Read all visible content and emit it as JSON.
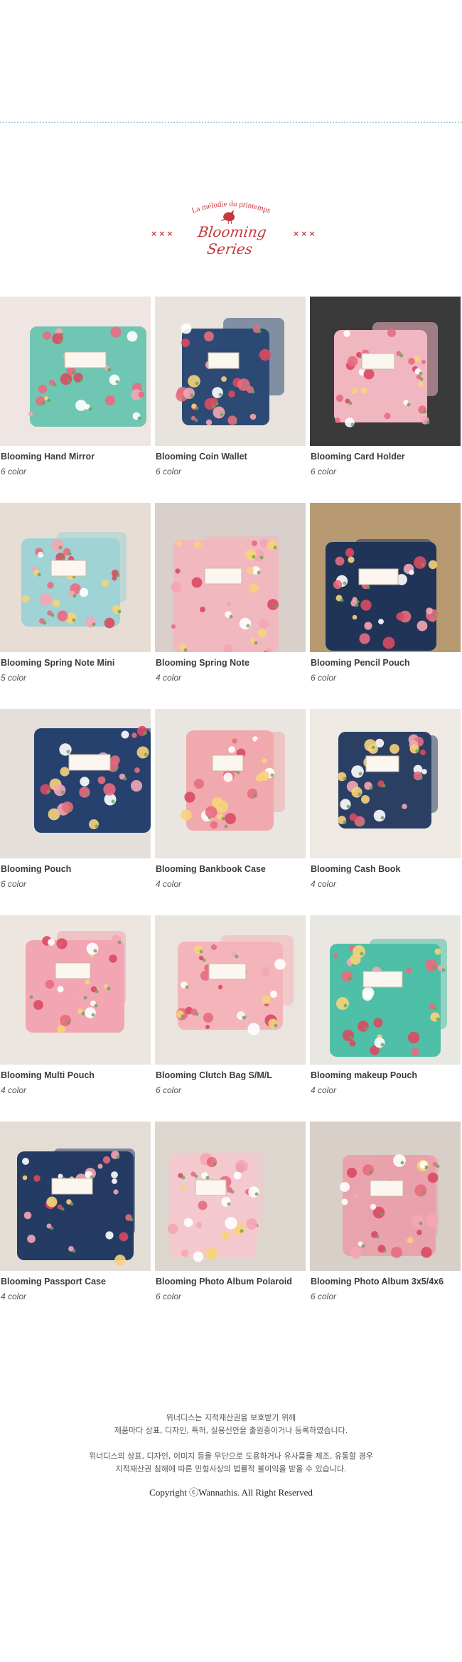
{
  "header": {
    "tagline": "La mélodie du printemps",
    "series_name": "Blooming Series",
    "marks_left": "×××",
    "marks_right": "×××",
    "accent_color": "#c8373a",
    "divider_color": "#a9cfe3"
  },
  "products": [
    {
      "name": "Blooming Hand Mirror",
      "colors": "6 color",
      "photo": "hand-mirror",
      "bg": "#efe6e3",
      "base": "#6fc6b2"
    },
    {
      "name": "Blooming Coin Wallet",
      "colors": "6 color",
      "photo": "coin-wallet",
      "bg": "#e8e3dc",
      "base": "#2c4a73"
    },
    {
      "name": "Blooming Card Holder",
      "colors": "6 color",
      "photo": "card-holder",
      "bg": "#3a3a3a",
      "base": "#f0b7c1"
    },
    {
      "name": "Blooming Spring Note Mini",
      "colors": "5 color",
      "photo": "spring-note-mini",
      "bg": "#e7ddd4",
      "base": "#9fd3d6"
    },
    {
      "name": "Blooming Spring Note",
      "colors": "4 color",
      "photo": "spring-note",
      "bg": "#d9cfcb",
      "base": "#f2b8bf"
    },
    {
      "name": "Blooming Pencil Pouch",
      "colors": "6 color",
      "photo": "pencil-pouch",
      "bg": "#b79a72",
      "base": "#1f3457"
    },
    {
      "name": "Blooming Pouch",
      "colors": "6 color",
      "photo": "pouch",
      "bg": "#e4dfda",
      "base": "#26416d"
    },
    {
      "name": "Blooming Bankbook Case",
      "colors": "4 color",
      "photo": "bankbook-case",
      "bg": "#e9e5e0",
      "base": "#f0a9ad"
    },
    {
      "name": "Blooming Cash Book",
      "colors": "4 color",
      "photo": "cash-book",
      "bg": "#eee9e3",
      "base": "#2a3f63"
    },
    {
      "name": "Blooming Multi Pouch",
      "colors": "4 color",
      "photo": "multi-pouch",
      "bg": "#ece5e0",
      "base": "#f2a6b3"
    },
    {
      "name": "Blooming Clutch Bag S/M/L",
      "colors": "6 color",
      "photo": "clutch-bag",
      "bg": "#eae4df",
      "base": "#f4b5ba"
    },
    {
      "name": "Blooming makeup Pouch",
      "colors": "4 color",
      "photo": "makeup-pouch",
      "bg": "#e9e7e1",
      "base": "#4fbfa7"
    },
    {
      "name": "Blooming Passport Case",
      "colors": "4 color",
      "photo": "passport-case",
      "bg": "#e3ddd6",
      "base": "#243b63"
    },
    {
      "name": "Blooming Photo Album Polaroid",
      "colors": "6 color",
      "photo": "photo-album-polaroid",
      "bg": "#ddd6cf",
      "base": "#f3c9cf"
    },
    {
      "name": "Blooming Photo Album 3x5/4x6",
      "colors": "6 color",
      "photo": "photo-album-3x5",
      "bg": "#d8d0c8",
      "base": "#e9a3ac"
    }
  ],
  "notice": {
    "line1": "위너디스는 지적재산권을 보호받기 위해",
    "line2": "제품마다 상표, 디자인, 특허, 실용신안을 출원중이거나 등록하였습니다.",
    "line3": "위너디스의 상표, 디자인, 이미지 등을 무단으로 도용하거나 유사품을 제조, 유통할 경우",
    "line4": "지적재산권 침해에 따른 민형사상의 법률적 불이익을 받을 수 있습니다.",
    "copyright": "Copyright ⓒWannathis. All Right Reserved"
  }
}
